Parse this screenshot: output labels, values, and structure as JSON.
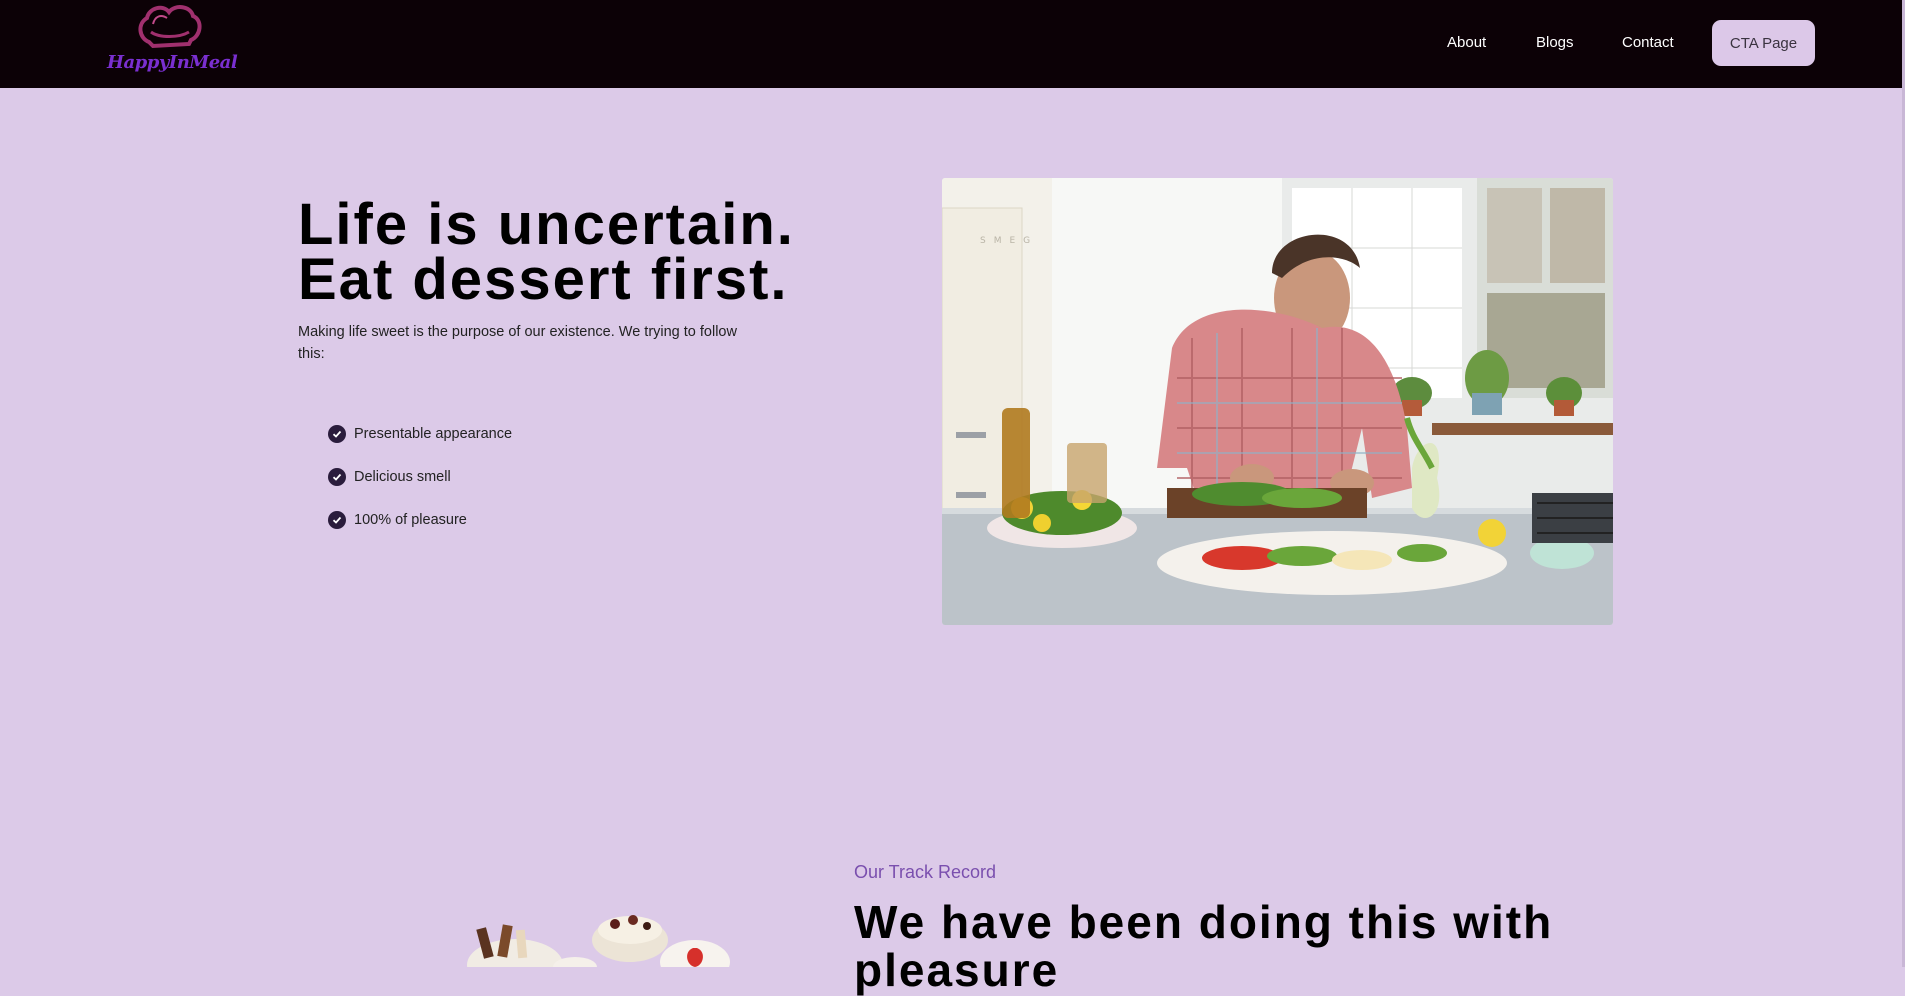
{
  "brand": {
    "name": "HappyInMeal",
    "logo_icon": "chef-hat-icon",
    "color": "#7a2fd0"
  },
  "nav": {
    "links": [
      "About",
      "Blogs",
      "Contact"
    ],
    "cta_label": "CTA Page"
  },
  "hero": {
    "title_line1": "Life is uncertain.",
    "title_line2": "Eat dessert first.",
    "subtitle": "Making life sweet is the purpose of our existence. We trying to follow this:",
    "features": [
      "Presentable appearance",
      "Delicious smell",
      "100% of pleasure"
    ],
    "image_subject": "chef-preparing-salad-photo"
  },
  "track_record": {
    "label": "Our Track Record",
    "title": "We have been doing this with pleasure",
    "image_subject": "desserts-photo"
  },
  "colors": {
    "background": "#dccae8",
    "navbar": "#0c0106",
    "cta_bg": "#dcc8e8",
    "accent_text": "#7a4fae",
    "check_icon": "#2a1c3c"
  }
}
